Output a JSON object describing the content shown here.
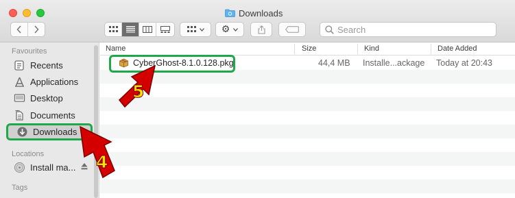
{
  "window": {
    "title": "Downloads"
  },
  "toolbar": {
    "back_label": "‹",
    "forward_label": "›",
    "action_label": "⚙",
    "search_placeholder": "Search"
  },
  "sidebar": {
    "favourites_header": "Favourites",
    "items": [
      {
        "label": "Recents",
        "icon": "recents-icon"
      },
      {
        "label": "Applications",
        "icon": "applications-icon"
      },
      {
        "label": "Desktop",
        "icon": "desktop-icon"
      },
      {
        "label": "Documents",
        "icon": "documents-icon"
      },
      {
        "label": "Downloads",
        "icon": "downloads-icon",
        "selected": true
      }
    ],
    "locations_header": "Locations",
    "locations": [
      {
        "label": "Install ma...",
        "icon": "disk-icon"
      }
    ],
    "tags_header": "Tags"
  },
  "columns": {
    "name": "Name",
    "size": "Size",
    "kind": "Kind",
    "date": "Date Added"
  },
  "files": [
    {
      "name": "CyberGhost-8.1.0.128.pkg",
      "size": "44,4 MB",
      "kind": "Installe...ackage",
      "date": "Today at 20:43",
      "icon": "package-icon"
    }
  ],
  "annotations": {
    "step_4": "4",
    "step_5": "5",
    "highlight_color": "#1fa84a",
    "arrow_color": "#d40000",
    "number_color": "#ffe100"
  }
}
